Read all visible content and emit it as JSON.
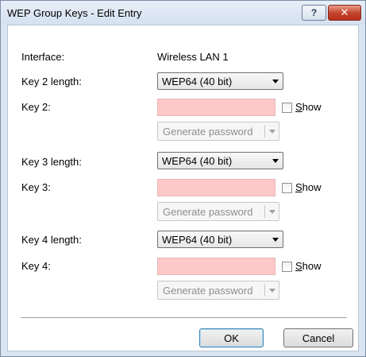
{
  "window": {
    "title": "WEP Group Keys - Edit Entry",
    "help_label": "?",
    "close_label": "✕"
  },
  "interface": {
    "label": "Interface:",
    "value": "Wireless LAN 1"
  },
  "keys": [
    {
      "length_label": "Key 2 length:",
      "length_value": "WEP64 (40 bit)",
      "key_label": "Key 2:",
      "key_value": "",
      "show_label": "Show",
      "generate_label": "Generate password"
    },
    {
      "length_label": "Key 3 length:",
      "length_value": "WEP64 (40 bit)",
      "key_label": "Key 3:",
      "key_value": "",
      "show_label": "Show",
      "generate_label": "Generate password"
    },
    {
      "length_label": "Key 4 length:",
      "length_value": "WEP64 (40 bit)",
      "key_label": "Key 4:",
      "key_value": "",
      "show_label": "Show",
      "generate_label": "Generate password"
    }
  ],
  "buttons": {
    "ok_label": "OK",
    "cancel_label": "Cancel"
  },
  "colors": {
    "invalid_field": "#ffc8c8",
    "close_button": "#c2432b"
  }
}
